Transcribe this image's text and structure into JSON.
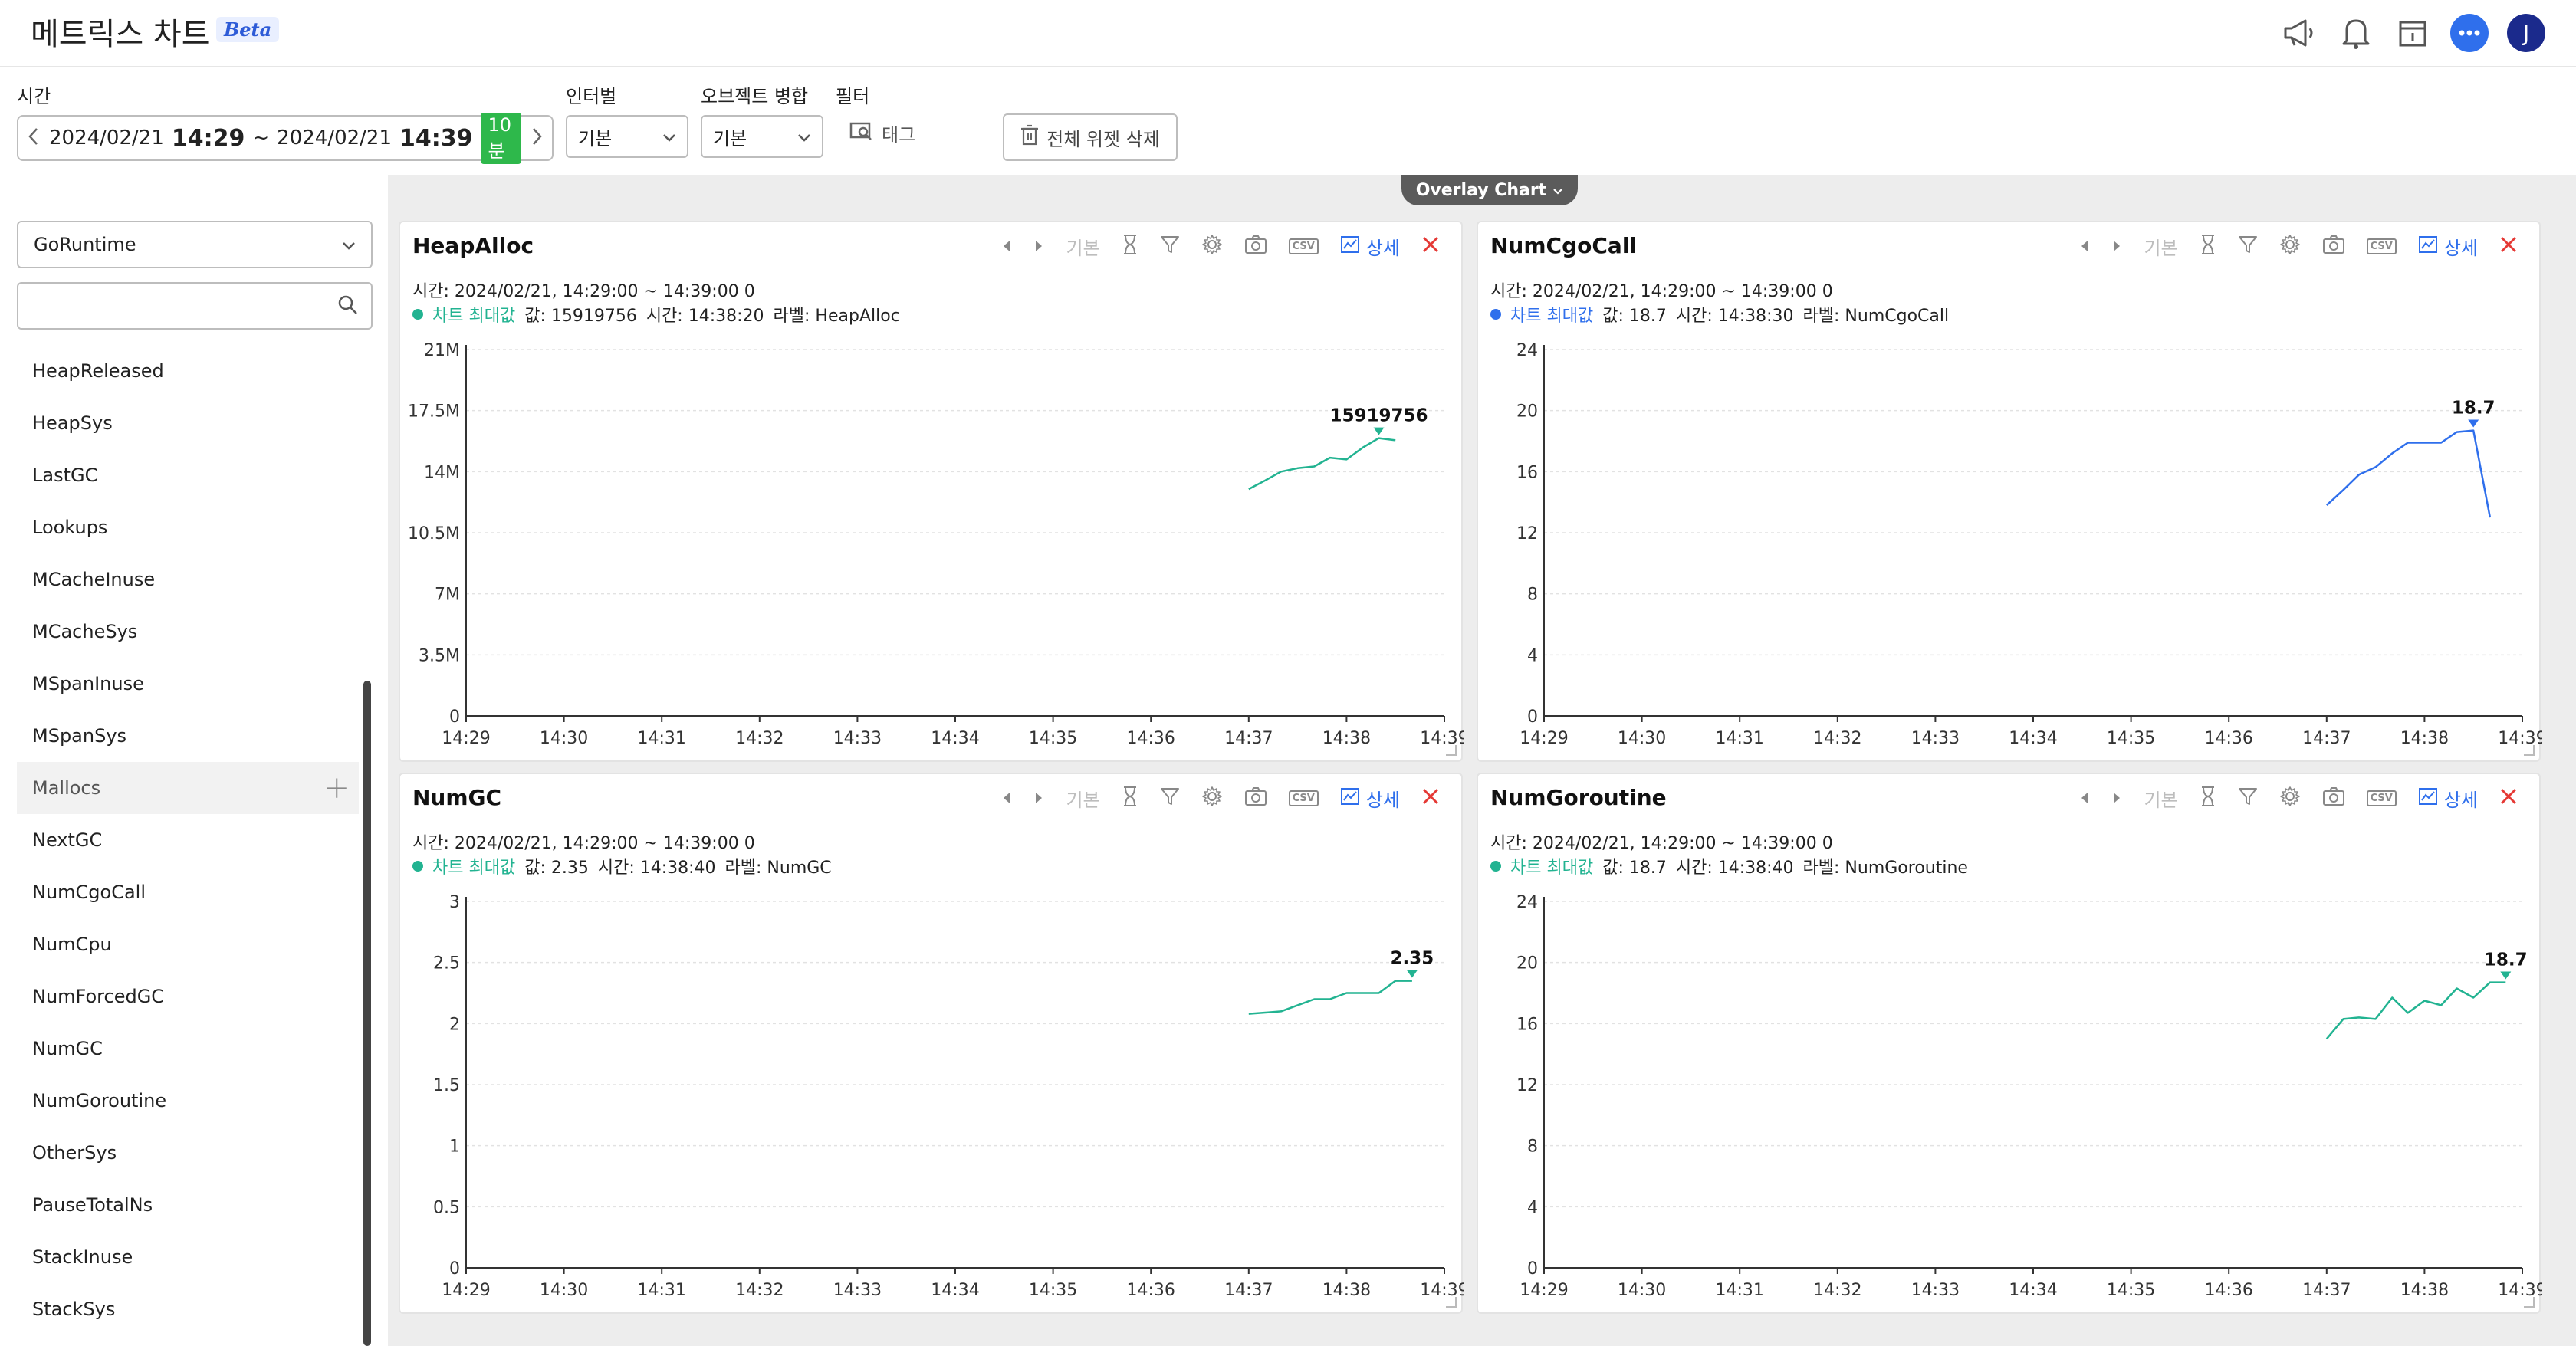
{
  "header": {
    "title": "메트릭스 차트",
    "beta": "Beta",
    "avatar": "J"
  },
  "colors": {
    "teal": "#22b391",
    "blue": "#2f6fec",
    "red": "#e53935"
  },
  "toolbar": {
    "time_label": "시간",
    "interval_label": "인터벌",
    "merge_label": "오브젝트 병합",
    "filter_label": "필터",
    "start_date": "2024/02/21",
    "start_time": "14:29",
    "separator": "~",
    "end_date": "2024/02/21",
    "end_time": "14:39",
    "range_badge": "10분",
    "interval_value": "기본",
    "merge_value": "기본",
    "tag_label": "태그",
    "delete_all_label": "전체 위젯 삭제"
  },
  "overlay": {
    "label": "Overlay Chart"
  },
  "sidebar": {
    "select_value": "GoRuntime",
    "search_placeholder": "",
    "items": [
      "HeapReleased",
      "HeapSys",
      "LastGC",
      "Lookups",
      "MCacheInuse",
      "MCacheSys",
      "MSpanInuse",
      "MSpanSys",
      "Mallocs",
      "NextGC",
      "NumCgoCall",
      "NumCpu",
      "NumForcedGC",
      "NumGC",
      "NumGoroutine",
      "OtherSys",
      "PauseTotalNs",
      "StackInuse",
      "StackSys"
    ],
    "active_item": "Mallocs"
  },
  "card_common": {
    "mode_label": "기본",
    "detail_label": "상세",
    "csv_label": "CSV"
  },
  "charts": [
    {
      "title": "HeapAlloc",
      "info": "시간: 2024/02/21, 14:29:00 ~ 14:39:00   0",
      "legend_series": "차트 최대값",
      "legend_value": "값: 15919756",
      "legend_time": "시간: 14:38:20",
      "legend_label": "라벨: HeapAlloc",
      "color": "#22b391",
      "peak_label": "15919756"
    },
    {
      "title": "NumCgoCall",
      "info": "시간: 2024/02/21, 14:29:00 ~ 14:39:00   0",
      "legend_series": "차트 최대값",
      "legend_value": "값: 18.7",
      "legend_time": "시간: 14:38:30",
      "legend_label": "라벨: NumCgoCall",
      "color": "#2f6fec",
      "peak_label": "18.7"
    },
    {
      "title": "NumGC",
      "info": "시간: 2024/02/21, 14:29:00 ~ 14:39:00   0",
      "legend_series": "차트 최대값",
      "legend_value": "값: 2.35",
      "legend_time": "시간: 14:38:40",
      "legend_label": "라벨: NumGC",
      "color": "#22b391",
      "peak_label": "2.35"
    },
    {
      "title": "NumGoroutine",
      "info": "시간: 2024/02/21, 14:29:00 ~ 14:39:00   0",
      "legend_series": "차트 최대값",
      "legend_value": "값: 18.7",
      "legend_time": "시간: 14:38:40",
      "legend_label": "라벨: NumGoroutine",
      "color": "#22b391",
      "peak_label": "18.7"
    }
  ],
  "chart_data": [
    {
      "type": "line",
      "title": "HeapAlloc",
      "x_ticks": [
        "14:29",
        "14:30",
        "14:31",
        "14:32",
        "14:33",
        "14:34",
        "14:35",
        "14:36",
        "14:37",
        "14:38",
        "14:39"
      ],
      "y_ticks": [
        "0",
        "3.5M",
        "7M",
        "10.5M",
        "14M",
        "17.5M",
        "21M"
      ],
      "ylim": [
        0,
        21000000
      ],
      "x": [
        8.0,
        8.17,
        8.33,
        8.5,
        8.67,
        8.83,
        9.0,
        9.17,
        9.33,
        9.5
      ],
      "values": [
        13000000,
        13500000,
        14000000,
        14200000,
        14300000,
        14800000,
        14700000,
        15400000,
        15919756,
        15800000
      ],
      "peak_index": 8,
      "grid": true
    },
    {
      "type": "line",
      "title": "NumCgoCall",
      "x_ticks": [
        "14:29",
        "14:30",
        "14:31",
        "14:32",
        "14:33",
        "14:34",
        "14:35",
        "14:36",
        "14:37",
        "14:38",
        "14:39"
      ],
      "y_ticks": [
        "0",
        "4",
        "8",
        "12",
        "16",
        "20",
        "24"
      ],
      "ylim": [
        0,
        24
      ],
      "x": [
        8.0,
        8.17,
        8.33,
        8.5,
        8.67,
        8.83,
        9.0,
        9.17,
        9.33,
        9.5,
        9.67
      ],
      "values": [
        13.8,
        14.8,
        15.8,
        16.3,
        17.2,
        17.9,
        17.9,
        17.9,
        18.6,
        18.7,
        13.0
      ],
      "peak_index": 9,
      "grid": true
    },
    {
      "type": "line",
      "title": "NumGC",
      "x_ticks": [
        "14:29",
        "14:30",
        "14:31",
        "14:32",
        "14:33",
        "14:34",
        "14:35",
        "14:36",
        "14:37",
        "14:38",
        "14:39"
      ],
      "y_ticks": [
        "0",
        "0.5",
        "1",
        "1.5",
        "2",
        "2.5",
        "3"
      ],
      "ylim": [
        0,
        3
      ],
      "x": [
        8.0,
        8.17,
        8.33,
        8.5,
        8.67,
        8.83,
        9.0,
        9.17,
        9.33,
        9.5,
        9.67
      ],
      "values": [
        2.08,
        2.09,
        2.1,
        2.15,
        2.2,
        2.2,
        2.25,
        2.25,
        2.25,
        2.35,
        2.35
      ],
      "peak_index": 10,
      "grid": true
    },
    {
      "type": "line",
      "title": "NumGoroutine",
      "x": [
        8.0,
        8.17,
        8.33,
        8.5,
        8.67,
        8.83,
        9.0,
        9.17,
        9.33,
        9.5,
        9.67,
        9.83
      ],
      "x_ticks": [
        "14:29",
        "14:30",
        "14:31",
        "14:32",
        "14:33",
        "14:34",
        "14:35",
        "14:36",
        "14:37",
        "14:38",
        "14:39"
      ],
      "y_ticks": [
        "0",
        "4",
        "8",
        "12",
        "16",
        "20",
        "24"
      ],
      "ylim": [
        0,
        24
      ],
      "values": [
        15.0,
        16.3,
        16.4,
        16.3,
        17.7,
        16.7,
        17.5,
        17.2,
        18.3,
        17.7,
        18.7,
        18.7
      ],
      "peak_index": 11,
      "grid": true
    }
  ]
}
